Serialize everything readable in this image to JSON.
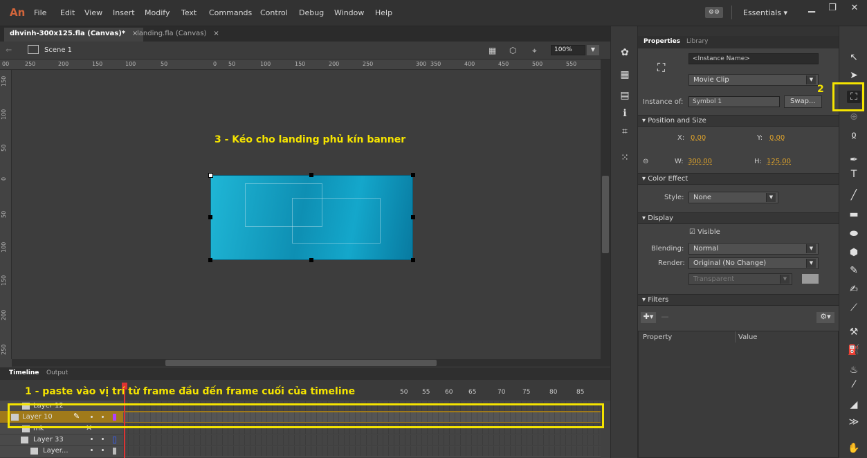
{
  "app": {
    "logo": "An",
    "menu": [
      "File",
      "Edit",
      "View",
      "Insert",
      "Modify",
      "Text",
      "Commands",
      "Control",
      "Debug",
      "Window",
      "Help"
    ],
    "workspace": "Essentials"
  },
  "tabs": [
    {
      "label": "dhvinh-300x125.fla (Canvas)*",
      "active": true
    },
    {
      "label": "landing.fla (Canvas)",
      "active": false
    }
  ],
  "scene": {
    "label": "Scene 1",
    "zoom": "100%"
  },
  "ruler_h_ticks": [
    "00",
    "250",
    "200",
    "150",
    "100",
    "50",
    "0",
    "50",
    "100",
    "150",
    "200",
    "250",
    "300",
    "350",
    "400",
    "450",
    "500",
    "550"
  ],
  "ruler_v_ticks": [
    "150",
    "100",
    "50",
    "0",
    "50",
    "100",
    "150",
    "200",
    "250"
  ],
  "annotations": {
    "step1": "1 - paste vào vị trí từ frame đầu đến frame cuối của timeline",
    "step2": "2",
    "step3": "3 - Kéo cho landing phủ kín banner"
  },
  "timeline": {
    "tabs": [
      "Timeline",
      "Output"
    ],
    "frame_numbers": [
      "50",
      "55",
      "60",
      "65",
      "70",
      "75",
      "80",
      "85"
    ],
    "layers": [
      {
        "name": "Layer 12"
      },
      {
        "name": "Layer 10",
        "selected": true,
        "color": "#b040ff"
      },
      {
        "name": "mk"
      },
      {
        "name": "Layer 33",
        "color": "#3b5bd9"
      },
      {
        "name": "Layer..."
      }
    ]
  },
  "properties": {
    "tabs": [
      "Properties",
      "Library"
    ],
    "instance_name_placeholder": "<Instance Name>",
    "type": "Movie Clip",
    "instance_of_label": "Instance of:",
    "instance_of": "Symbol 1",
    "swap": "Swap...",
    "sections": {
      "position": "Position and Size",
      "color": "Color Effect",
      "display": "Display",
      "filters": "Filters"
    },
    "x_label": "X:",
    "x": "0.00",
    "y_label": "Y:",
    "y": "0.00",
    "w_label": "W:",
    "w": "300.00",
    "h_label": "H:",
    "h": "125.00",
    "style_label": "Style:",
    "style": "None",
    "visible": "Visible",
    "blending_label": "Blending:",
    "blending": "Normal",
    "render_label": "Render:",
    "render": "Original (No Change)",
    "transparent": "Transparent",
    "filter_cols": [
      "Property",
      "Value"
    ]
  },
  "colors": {
    "accent_yellow": "#f5e400",
    "banner": "#14a7cb"
  }
}
